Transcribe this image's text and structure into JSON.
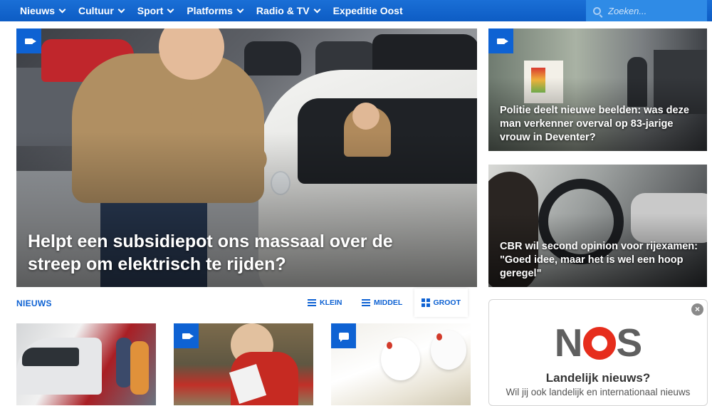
{
  "nav": {
    "items": [
      {
        "label": "Nieuws",
        "dropdown": true
      },
      {
        "label": "Cultuur",
        "dropdown": true
      },
      {
        "label": "Sport",
        "dropdown": true
      },
      {
        "label": "Platforms",
        "dropdown": true
      },
      {
        "label": "Radio & TV",
        "dropdown": true
      },
      {
        "label": "Expeditie Oost",
        "dropdown": false
      }
    ],
    "search_placeholder": "Zoeken..."
  },
  "hero": {
    "title": "Helpt een subsidiepot ons massaal over de streep om elektrisch te rijden?",
    "media_icon": "video-camera-icon"
  },
  "side_articles": [
    {
      "title": "Politie deelt nieuwe beelden: was deze man verkenner overval op 83-jarige vrouw in Deventer?",
      "media_icon": "video-camera-icon"
    },
    {
      "title": "CBR wil second opinion voor rijexamen: \"Goed idee, maar het is wel een hoop geregel\"",
      "media_icon": null
    }
  ],
  "section": {
    "title": "NIEUWS",
    "views": [
      {
        "label": "KLEIN",
        "icon": "list-icon",
        "active": false
      },
      {
        "label": "MIDDEL",
        "icon": "list-icon",
        "active": false
      },
      {
        "label": "GROOT",
        "icon": "grid-icon",
        "active": true
      }
    ]
  },
  "thumbnails": [
    {
      "media_icon": null
    },
    {
      "media_icon": "video-camera-icon"
    },
    {
      "media_icon": "chat-icon"
    }
  ],
  "ad": {
    "logo": "NOS",
    "heading": "Landelijk nieuws?",
    "text": "Wil jij ook landelijk en internationaal nieuws",
    "close_label": "×"
  },
  "colors": {
    "brand_blue": "#0e62d3",
    "nav_blue": "#1a6fd6",
    "nos_red": "#e62d1c"
  }
}
